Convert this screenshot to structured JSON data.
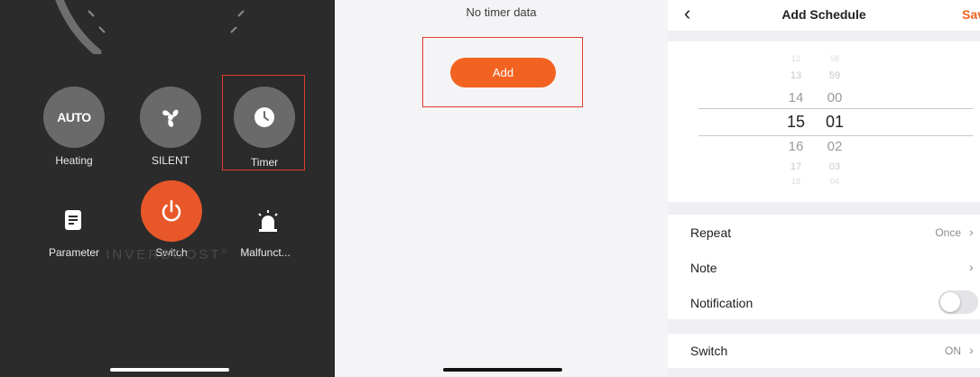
{
  "panel1": {
    "buttons": [
      {
        "label": "Heating",
        "icon_text": "AUTO",
        "icon": "auto-icon"
      },
      {
        "label": "SILENT",
        "icon": "fan-icon"
      },
      {
        "label": "Timer",
        "icon": "clock-icon"
      },
      {
        "label": "Parameter",
        "icon": "document-icon"
      },
      {
        "label": "Switch",
        "icon": "power-icon"
      },
      {
        "label": "Malfunct...",
        "icon": "alarm-icon"
      }
    ],
    "brand": "INVERBOOST",
    "brand_mark": "®",
    "colors": {
      "background": "#2b2b2b",
      "power": "#e8572a",
      "button": "#6a6a6a",
      "highlight": "#e23a2e"
    }
  },
  "panel2": {
    "empty_text": "No timer data",
    "add_label": "Add",
    "colors": {
      "add_button": "#f26321"
    }
  },
  "panel3": {
    "title": "Add Schedule",
    "save_label": "Save",
    "back_icon": "chevron-left-icon",
    "picker": {
      "hours": [
        "12",
        "13",
        "14",
        "15",
        "16",
        "17",
        "18"
      ],
      "minutes": [
        "58",
        "59",
        "00",
        "01",
        "02",
        "03",
        "04"
      ],
      "selected_hour": "15",
      "selected_minute": "01"
    },
    "rows": [
      {
        "label": "Repeat",
        "value": "Once"
      },
      {
        "label": "Note",
        "value": ""
      },
      {
        "label": "Notification",
        "toggle": false
      },
      {
        "label": "Switch",
        "value": "ON"
      }
    ]
  }
}
